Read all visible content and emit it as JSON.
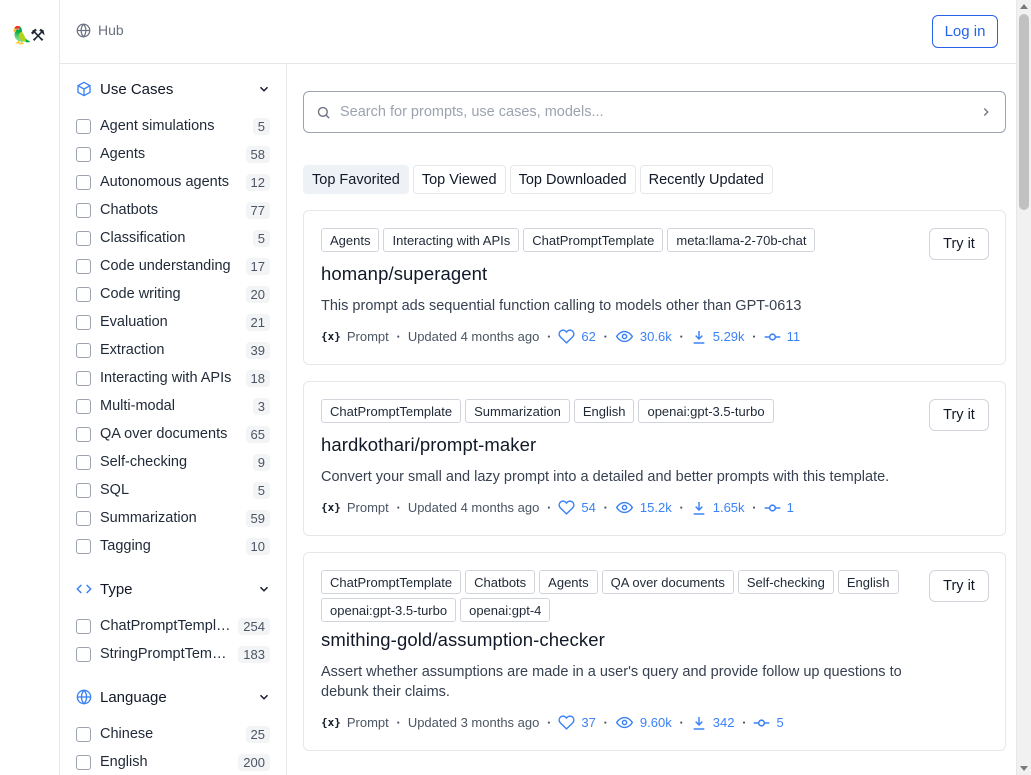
{
  "app": {
    "logo": "🦜⚒",
    "hub_label": "Hub",
    "login_label": "Log in"
  },
  "sidebar": {
    "use_cases": {
      "title": "Use Cases",
      "items": [
        {
          "label": "Agent simulations",
          "count": "5"
        },
        {
          "label": "Agents",
          "count": "58"
        },
        {
          "label": "Autonomous agents",
          "count": "12"
        },
        {
          "label": "Chatbots",
          "count": "77"
        },
        {
          "label": "Classification",
          "count": "5"
        },
        {
          "label": "Code understanding",
          "count": "17"
        },
        {
          "label": "Code writing",
          "count": "20"
        },
        {
          "label": "Evaluation",
          "count": "21"
        },
        {
          "label": "Extraction",
          "count": "39"
        },
        {
          "label": "Interacting with APIs",
          "count": "18"
        },
        {
          "label": "Multi-modal",
          "count": "3"
        },
        {
          "label": "QA over documents",
          "count": "65"
        },
        {
          "label": "Self-checking",
          "count": "9"
        },
        {
          "label": "SQL",
          "count": "5"
        },
        {
          "label": "Summarization",
          "count": "59"
        },
        {
          "label": "Tagging",
          "count": "10"
        }
      ]
    },
    "type": {
      "title": "Type",
      "items": [
        {
          "label": "ChatPromptTemplate",
          "count": "254"
        },
        {
          "label": "StringPromptTemplate",
          "count": "183"
        }
      ]
    },
    "language": {
      "title": "Language",
      "items": [
        {
          "label": "Chinese",
          "count": "25"
        },
        {
          "label": "English",
          "count": "200"
        }
      ]
    }
  },
  "search": {
    "placeholder": "Search for prompts, use cases, models..."
  },
  "tabs": [
    {
      "label": "Top Favorited",
      "active": true
    },
    {
      "label": "Top Viewed",
      "active": false
    },
    {
      "label": "Top Downloaded",
      "active": false
    },
    {
      "label": "Recently Updated",
      "active": false
    }
  ],
  "cards": [
    {
      "tags": [
        "Agents",
        "Interacting with APIs",
        "ChatPromptTemplate",
        "meta:llama-2-70b-chat"
      ],
      "title": "homanp/superagent",
      "description": "This prompt ads sequential function calling to models other than GPT-0613",
      "kind": "Prompt",
      "updated": "Updated 4 months ago",
      "likes": "62",
      "views": "30.6k",
      "downloads": "5.29k",
      "commits": "11",
      "try_label": "Try it"
    },
    {
      "tags": [
        "ChatPromptTemplate",
        "Summarization",
        "English",
        "openai:gpt-3.5-turbo"
      ],
      "title": "hardkothari/prompt-maker",
      "description": "Convert your small and lazy prompt into a detailed and better prompts with this template.",
      "kind": "Prompt",
      "updated": "Updated 4 months ago",
      "likes": "54",
      "views": "15.2k",
      "downloads": "1.65k",
      "commits": "1",
      "try_label": "Try it"
    },
    {
      "tags": [
        "ChatPromptTemplate",
        "Chatbots",
        "Agents",
        "QA over documents",
        "Self-checking",
        "English",
        "openai:gpt-3.5-turbo",
        "openai:gpt-4"
      ],
      "title": "smithing-gold/assumption-checker",
      "description": "Assert whether assumptions are made in a user's query and provide follow up questions to debunk their claims.",
      "kind": "Prompt",
      "updated": "Updated 3 months ago",
      "likes": "37",
      "views": "9.60k",
      "downloads": "342",
      "commits": "5",
      "try_label": "Try it"
    }
  ],
  "colors": {
    "accent": "#2563eb",
    "stat_blue": "#3b82f6",
    "border": "#e5e7eb"
  }
}
